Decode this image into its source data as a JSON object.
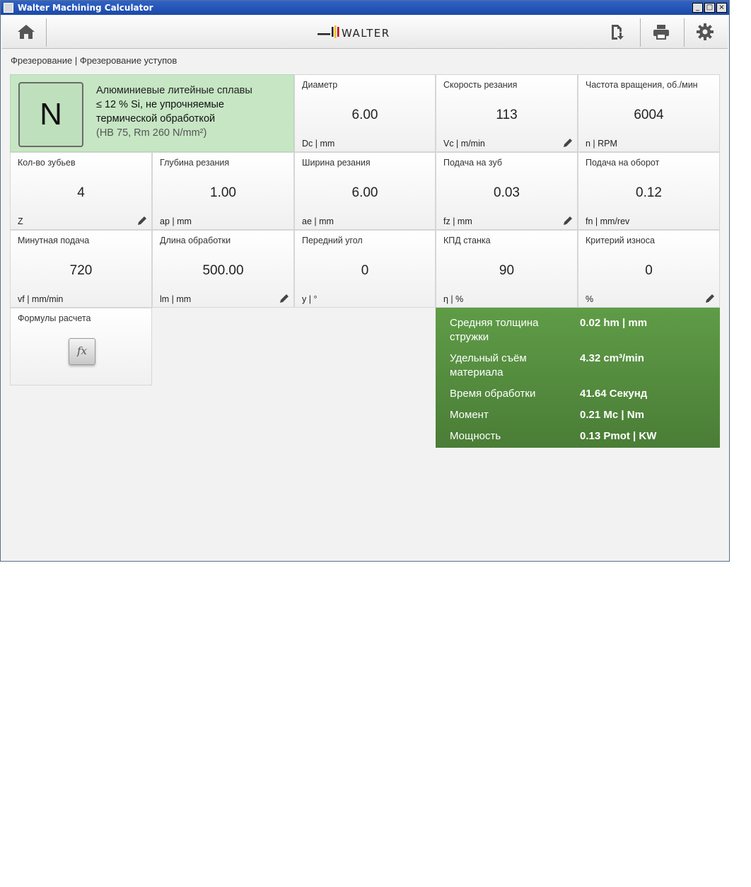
{
  "window": {
    "title": "Walter Machining Calculator",
    "buttons": [
      "_",
      "□",
      "×"
    ]
  },
  "toolbar": {
    "icons": [
      "home-icon",
      "export-icon",
      "print-icon",
      "gear-icon"
    ],
    "brand": "WALTER",
    "brand_colors": {
      "black": "#222222",
      "yellow": "#f2c500",
      "red": "#d0021b"
    }
  },
  "breadcrumb": "Фрезерование | Фрезерование уступов",
  "material": {
    "letter": "N",
    "line1": "Алюминиевые литейные сплавы",
    "line2": "≤ 12 % Si, не упрочняемые термической обработкой",
    "line3": "(HB 75, Rm 260 N/mm²)",
    "color": "#c6e6c4"
  },
  "params": [
    {
      "label": "Диаметр",
      "value": "6.00",
      "unit": "Dc | mm",
      "editable": false
    },
    {
      "label": "Скорость резания",
      "value": "113",
      "unit": "Vc | m/min",
      "editable": true
    },
    {
      "label": "Частота вращения, об./мин",
      "value": "6004",
      "unit": "n | RPM",
      "editable": false
    },
    {
      "label": "Кол-во зубьев",
      "value": "4",
      "unit": "Z",
      "editable": true
    },
    {
      "label": "Глубина резания",
      "value": "1.00",
      "unit": "ap | mm",
      "editable": false
    },
    {
      "label": "Ширина резания",
      "value": "6.00",
      "unit": "ae | mm",
      "editable": false
    },
    {
      "label": "Подача на зуб",
      "value": "0.03",
      "unit": "fz | mm",
      "editable": true
    },
    {
      "label": "Подача на оборот",
      "value": "0.12",
      "unit": "fn | mm/rev",
      "editable": false
    },
    {
      "label": "Минутная подача",
      "value": "720",
      "unit": "vf | mm/min",
      "editable": false
    },
    {
      "label": "Длина обработки",
      "value": "500.00",
      "unit": "lm | mm",
      "editable": true
    },
    {
      "label": "Передний угол",
      "value": "0",
      "unit": "y | °",
      "editable": false
    },
    {
      "label": "КПД станка",
      "value": "90",
      "unit": "η | %",
      "editable": false
    },
    {
      "label": "Критерий износа",
      "value": "0",
      "unit": "%",
      "editable": true
    }
  ],
  "formulas": {
    "label": "Формулы расчета",
    "button": "fx"
  },
  "results": {
    "color": "#558c3e",
    "rows": [
      {
        "name": "Средняя толщина стружки",
        "value": "0.02 hm | mm"
      },
      {
        "name": "Удельный съём материала",
        "value": "4.32 cm³/min"
      },
      {
        "name": "Время обработки",
        "value": "41.64 Секунд"
      },
      {
        "name": "Момент",
        "value": "0.21 Mc | Nm"
      },
      {
        "name": "Мощность",
        "value": "0.13 Pmot | KW"
      }
    ]
  }
}
